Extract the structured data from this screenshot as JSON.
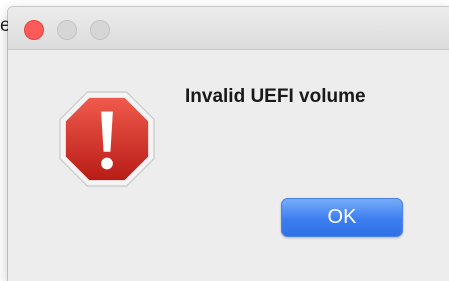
{
  "background": {
    "fragment": "e"
  },
  "window": {
    "buttons": [
      "close",
      "minimize",
      "zoom"
    ]
  },
  "alert": {
    "icon": "stop-exclamation-icon",
    "message": "Invalid UEFI volume",
    "ok_label": "OK"
  },
  "colors": {
    "close": "#fc5b57",
    "icon_red": "#d42a22",
    "button_blue": "#3c7ef0"
  }
}
